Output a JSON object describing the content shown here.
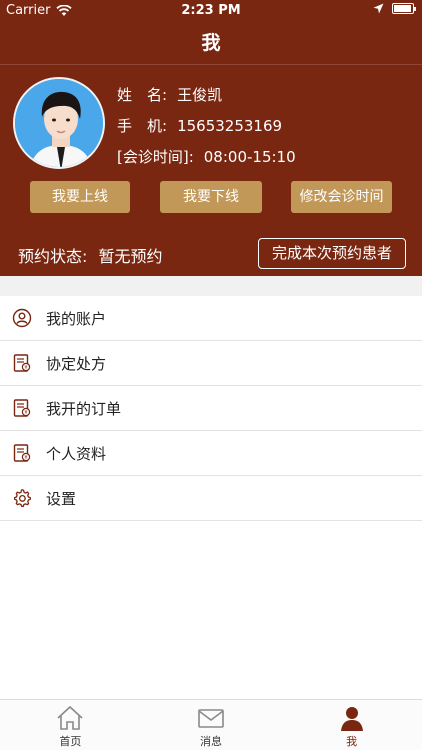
{
  "status_bar": {
    "carrier": "Carrier",
    "time": "2:23 PM"
  },
  "nav": {
    "title": "我"
  },
  "profile": {
    "name_label": "姓　名:",
    "name_value": "王俊凯",
    "phone_label": "手　机:",
    "phone_value": "15653253169",
    "time_label": "[会诊时间]:",
    "time_value": "08:00-15:10"
  },
  "actions": {
    "online": "我要上线",
    "offline": "我要下线",
    "edit_time": "修改会诊时间"
  },
  "appointment": {
    "status_label": "预约状态:",
    "status_value": "暂无预约",
    "complete_button": "完成本次预约患者"
  },
  "menu": [
    {
      "label": "我的账户",
      "icon": "user-circle-icon"
    },
    {
      "label": "协定处方",
      "icon": "document-icon"
    },
    {
      "label": "我开的订单",
      "icon": "document-icon"
    },
    {
      "label": "个人资料",
      "icon": "document-icon"
    },
    {
      "label": "设置",
      "icon": "gear-icon"
    }
  ],
  "tabs": [
    {
      "label": "首页",
      "icon": "home-icon"
    },
    {
      "label": "消息",
      "icon": "mail-icon"
    },
    {
      "label": "我",
      "icon": "person-icon"
    }
  ],
  "colors": {
    "header_bg": "#7a2712",
    "button_gold": "#c29858",
    "active_tab": "#7a2712"
  }
}
